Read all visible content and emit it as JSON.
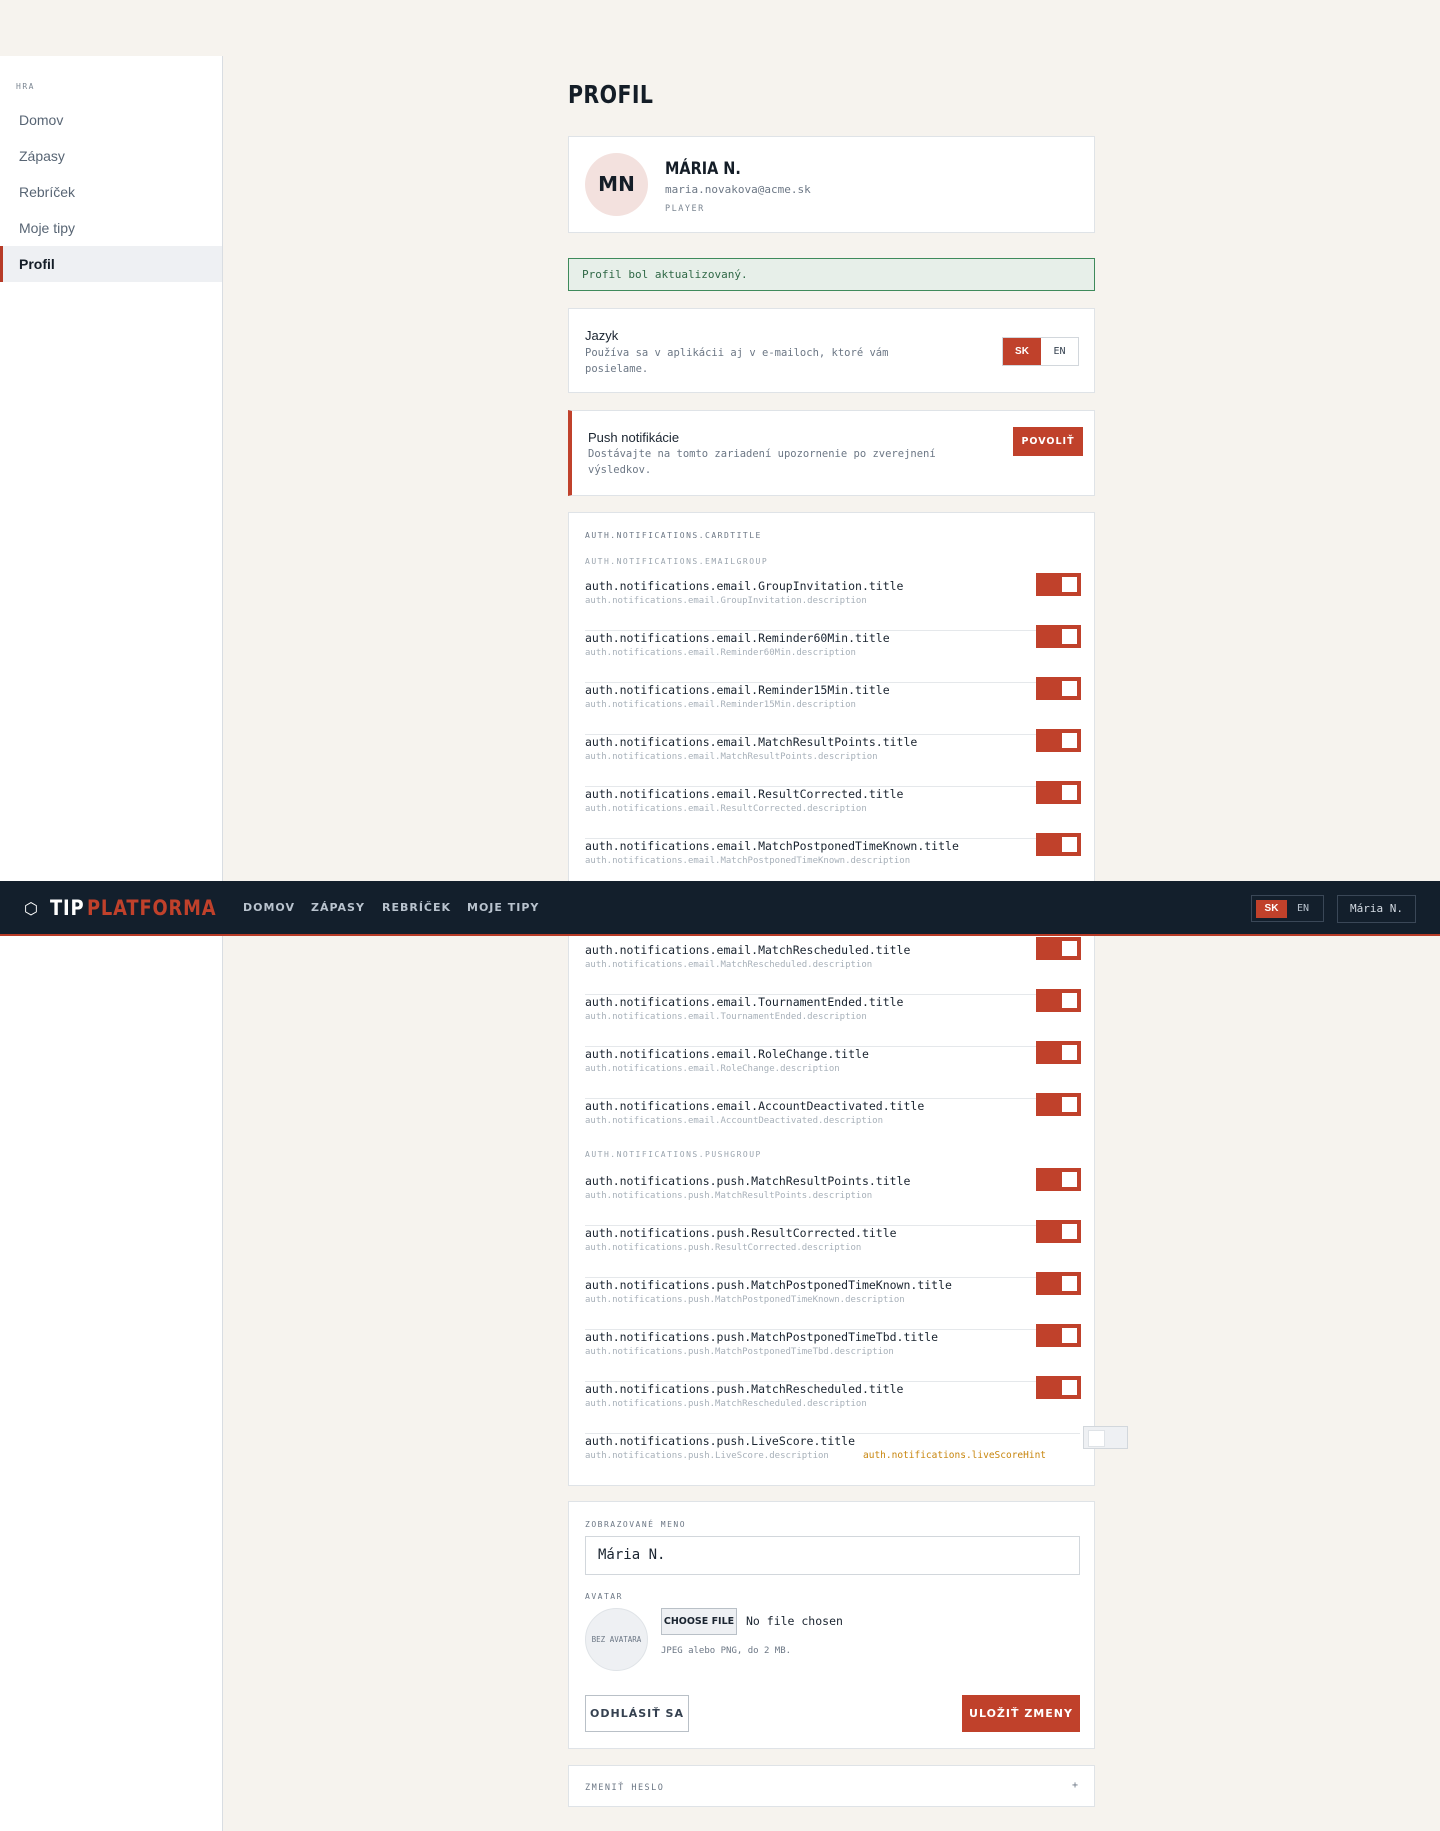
{
  "sidebar": {
    "section": "HRA",
    "items": [
      {
        "label": "Domov"
      },
      {
        "label": "Zápasy"
      },
      {
        "label": "Rebríček"
      },
      {
        "label": "Moje tipy"
      },
      {
        "label": "Profil",
        "active": true
      }
    ]
  },
  "topnav": {
    "logo_icon": "⬡",
    "logo_part1": "TIP",
    "logo_part2": "PLATFORMA",
    "links": [
      "DOMOV",
      "ZÁPASY",
      "REBRÍČEK",
      "MOJE TIPY"
    ],
    "lang_active": "SK",
    "lang_other": "EN",
    "user": "Mária N."
  },
  "page": {
    "title": "PROFIL"
  },
  "profile": {
    "initials": "MN",
    "name": "MÁRIA N.",
    "email": "maria.novakova@acme.sk",
    "role": "PLAYER"
  },
  "alert": {
    "text": "Profil bol aktualizovaný."
  },
  "language": {
    "title": "Jazyk",
    "desc_line1": "Používa sa v aplikácii aj v e-mailoch, ktoré vám",
    "desc_line2": "posielame.",
    "options": [
      "SK",
      "EN"
    ],
    "selected": "SK"
  },
  "push": {
    "title": "Push notifikácie",
    "desc_line1": "Dostávajte na tomto zariadení upozornenie po zverejnení",
    "desc_line2": "výsledkov.",
    "button": "POVOLIŤ"
  },
  "notifications": {
    "card_title": "AUTH.NOTIFICATIONS.CARDTITLE",
    "email_group": "AUTH.NOTIFICATIONS.EMAILGROUP",
    "push_group": "AUTH.NOTIFICATIONS.PUSHGROUP",
    "email": [
      {
        "title": "auth.notifications.email.GroupInvitation.title",
        "desc": "auth.notifications.email.GroupInvitation.description",
        "on": true
      },
      {
        "title": "auth.notifications.email.Reminder60Min.title",
        "desc": "auth.notifications.email.Reminder60Min.description",
        "on": true
      },
      {
        "title": "auth.notifications.email.Reminder15Min.title",
        "desc": "auth.notifications.email.Reminder15Min.description",
        "on": true
      },
      {
        "title": "auth.notifications.email.MatchResultPoints.title",
        "desc": "auth.notifications.email.MatchResultPoints.description",
        "on": true
      },
      {
        "title": "auth.notifications.email.ResultCorrected.title",
        "desc": "auth.notifications.email.ResultCorrected.description",
        "on": true
      },
      {
        "title": "auth.notifications.email.MatchPostponedTimeKnown.title",
        "desc": "auth.notifications.email.MatchPostponedTimeKnown.description",
        "on": true
      },
      {
        "title": "auth.notifications.email.MatchRescheduled.title",
        "desc": "auth.notifications.email.MatchRescheduled.description",
        "on": true
      },
      {
        "title": "auth.notifications.email.TournamentEnded.title",
        "desc": "auth.notifications.email.TournamentEnded.description",
        "on": true
      },
      {
        "title": "auth.notifications.email.RoleChange.title",
        "desc": "auth.notifications.email.RoleChange.description",
        "on": true
      },
      {
        "title": "auth.notifications.email.AccountDeactivated.title",
        "desc": "auth.notifications.email.AccountDeactivated.description",
        "on": true
      }
    ],
    "push": [
      {
        "title": "auth.notifications.push.MatchResultPoints.title",
        "desc": "auth.notifications.push.MatchResultPoints.description",
        "on": true
      },
      {
        "title": "auth.notifications.push.ResultCorrected.title",
        "desc": "auth.notifications.push.ResultCorrected.description",
        "on": true
      },
      {
        "title": "auth.notifications.push.MatchPostponedTimeKnown.title",
        "desc": "auth.notifications.push.MatchPostponedTimeKnown.description",
        "on": true
      },
      {
        "title": "auth.notifications.push.MatchPostponedTimeTbd.title",
        "desc": "auth.notifications.push.MatchPostponedTimeTbd.description",
        "on": true
      },
      {
        "title": "auth.notifications.push.MatchRescheduled.title",
        "desc": "auth.notifications.push.MatchRescheduled.description",
        "on": true
      },
      {
        "title": "auth.notifications.push.LiveScore.title",
        "desc": "auth.notifications.push.LiveScore.description",
        "hint": "auth.notifications.liveScoreHint",
        "on": false
      }
    ]
  },
  "form": {
    "display_name_label": "ZOBRAZOVANÉ MENO",
    "display_name_value": "Mária N.",
    "avatar_label": "AVATAR",
    "no_avatar": "BEZ AVATARA",
    "choose_file": "CHOOSE FILE",
    "no_file": "No file chosen",
    "file_hint": "JPEG alebo PNG, do 2 MB.",
    "logout": "ODHLÁSIŤ SA",
    "save": "ULOŽIŤ ZMENY"
  },
  "password": {
    "label": "ZMENIŤ HESLO",
    "expand": "+"
  },
  "colors": {
    "accent": "#c0412b",
    "nav_bg": "#131f2c",
    "page_bg": "#f6f3ee",
    "success": "#3e8a5b"
  }
}
